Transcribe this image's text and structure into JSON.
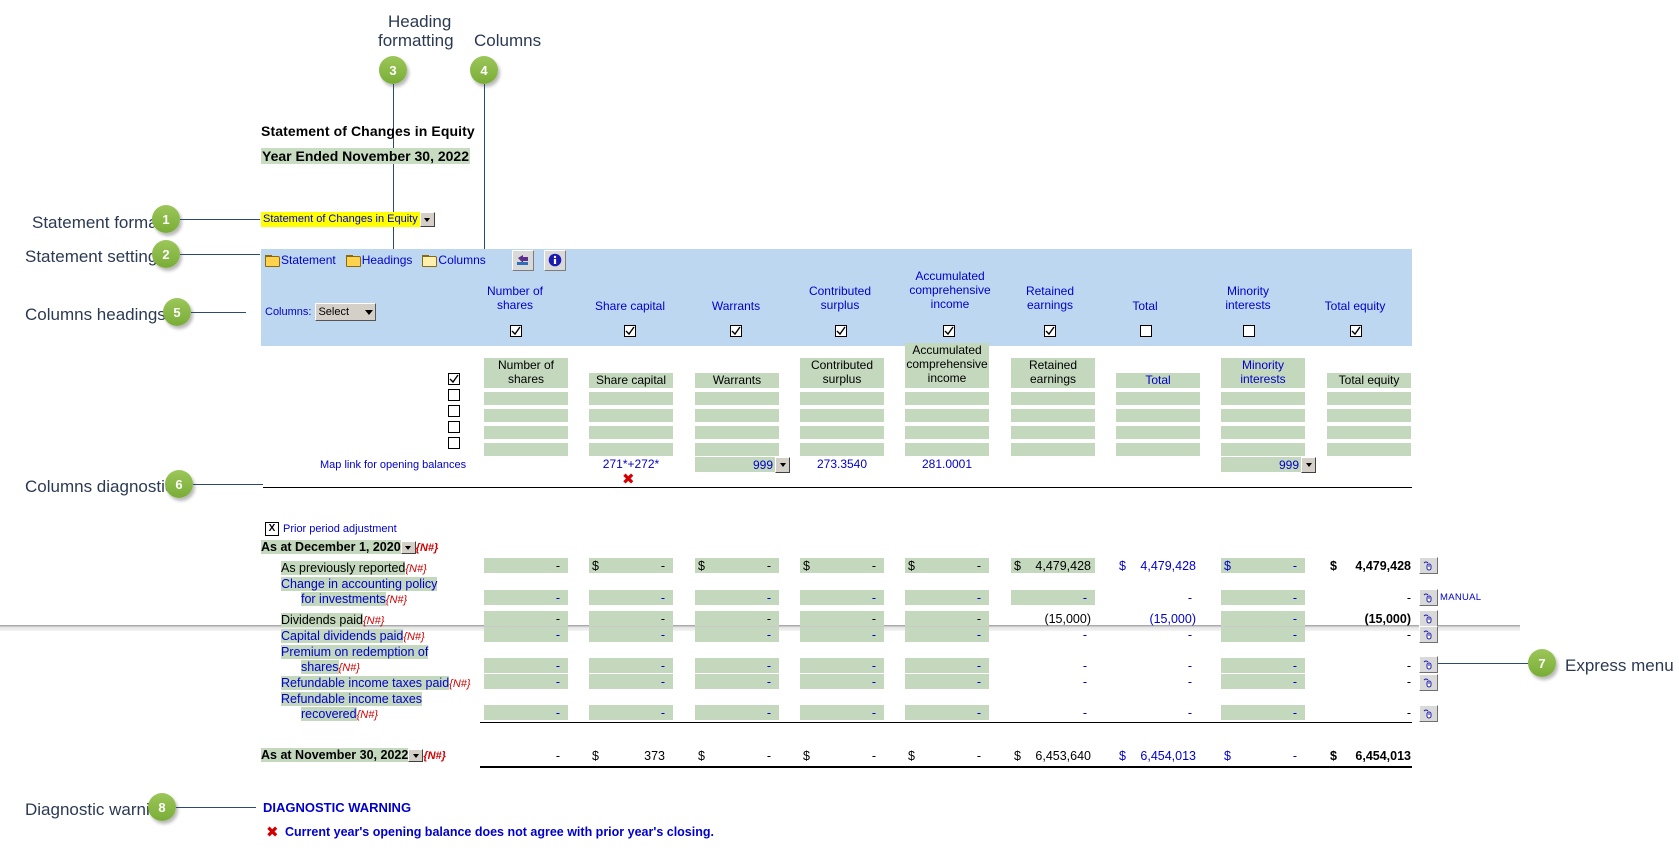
{
  "callouts": [
    {
      "n": "1",
      "label": "Statement format"
    },
    {
      "n": "2",
      "label": "Statement settings"
    },
    {
      "n": "3",
      "label": "Heading\nformatting"
    },
    {
      "n": "4",
      "label": "Columns"
    },
    {
      "n": "5",
      "label": "Columns headings"
    },
    {
      "n": "6",
      "label": "Columns diagnostic"
    },
    {
      "n": "7",
      "label": "Express menu"
    },
    {
      "n": "8",
      "label": "Diagnostic warning"
    }
  ],
  "callout_texts": {
    "c1": "Statement format",
    "c2": "Statement settings",
    "c3_line1": "Heading",
    "c3_line2": "formatting",
    "c4": "Columns",
    "c5": "Columns headings",
    "c6": "Columns diagnostic",
    "c7": "Express menu",
    "c8": "Diagnostic warning",
    "n1": "1",
    "n2": "2",
    "n3": "3",
    "n4": "4",
    "n5": "5",
    "n6": "6",
    "n7": "7",
    "n8": "8"
  },
  "statement": {
    "title": "Statement of Changes in Equity",
    "subtitle": "Year Ended November 30, 2022",
    "format_select_value": "Statement of Changes in Equity"
  },
  "settings_tabs": [
    {
      "label": "Statement",
      "icon": "folder-icon"
    },
    {
      "label": "Headings",
      "icon": "folder-icon"
    },
    {
      "label": "Columns",
      "icon": "folder-open-icon"
    }
  ],
  "toolbar": {
    "refresh_icon": "undo-arrow-icon",
    "info_icon": "info-icon"
  },
  "columns_selector": {
    "label": "Columns:",
    "value": "Select"
  },
  "columns": [
    {
      "name": "Number of shares",
      "line1": "Number of",
      "line2": "shares",
      "checked": true,
      "header_blue": true,
      "grid_header_blue": false,
      "map": ""
    },
    {
      "name": "Share capital",
      "line1": "Share capital",
      "line2": "",
      "checked": true,
      "header_blue": true,
      "grid_header_blue": false,
      "map": "271*+272*"
    },
    {
      "name": "Warrants",
      "line1": "Warrants",
      "line2": "",
      "checked": true,
      "header_blue": true,
      "grid_header_blue": false,
      "map": "999"
    },
    {
      "name": "Contributed surplus",
      "line1": "Contributed",
      "line2": "surplus",
      "checked": true,
      "header_blue": true,
      "grid_header_blue": false,
      "map": "273.3540"
    },
    {
      "name": "Accumulated comprehensive income",
      "line1": "Accumulated",
      "line2": "comprehensive",
      "line3": "income",
      "checked": true,
      "header_blue": true,
      "grid_header_blue": false,
      "map": "281.0001"
    },
    {
      "name": "Retained earnings",
      "line1": "Retained",
      "line2": "earnings",
      "checked": true,
      "header_blue": true,
      "grid_header_blue": false,
      "map": ""
    },
    {
      "name": "Total",
      "line1": "Total",
      "line2": "",
      "checked": false,
      "header_blue": true,
      "grid_header_blue": true,
      "map": ""
    },
    {
      "name": "Minority interests",
      "line1": "Minority",
      "line2": "interests",
      "checked": false,
      "header_blue": true,
      "grid_header_blue": true,
      "map": "999"
    },
    {
      "name": "Total equity",
      "line1": "Total equity",
      "line2": "",
      "checked": true,
      "header_blue": true,
      "grid_header_blue": false,
      "map": ""
    }
  ],
  "grid": {
    "map_link_label": "Map link for opening balances",
    "row_checkboxes": [
      true,
      false,
      false,
      false,
      false
    ]
  },
  "body": {
    "prior_period_adjustment": "Prior period adjustment",
    "prior_period_checked": "X",
    "opening_row_label": "As at December 1, 2020",
    "opening_row_tag": "{N#}",
    "closing_row_label": "As at November 30, 2022",
    "closing_row_tag": "{N#}",
    "manual_tag": "MANUAL",
    "rows": [
      {
        "label": "As previously reported",
        "tag": "{N#}",
        "label_color": "black"
      },
      {
        "label": "Change in accounting policy for investments",
        "tag": "{N#}",
        "label_color": "blue"
      },
      {
        "label": "Dividends paid",
        "tag": "{N#}",
        "label_color": "black"
      },
      {
        "label": "Capital dividends paid",
        "tag": "{N#}",
        "label_color": "blue"
      },
      {
        "label": "Premium on redemption of shares",
        "tag": "{N#}",
        "label_color": "blue"
      },
      {
        "label": "Refundable income taxes paid",
        "tag": "{N#}",
        "label_color": "blue"
      },
      {
        "label": "Refundable income taxes recovered",
        "tag": "{N#}",
        "label_color": "blue"
      }
    ],
    "values": {
      "as_previously_reported": [
        "-",
        "-",
        "-",
        "-",
        "-",
        "4,479,428",
        "4,479,428",
        "-",
        "4,479,428"
      ],
      "change_in_policy": [
        "-",
        "-",
        "-",
        "-",
        "-",
        "-",
        "-",
        "-",
        "-"
      ],
      "dividends_paid": [
        "-",
        "-",
        "-",
        "-",
        "-",
        "(15,000)",
        "(15,000)",
        "-",
        "(15,000)"
      ],
      "capital_dividends": [
        "-",
        "-",
        "-",
        "-",
        "-",
        "-",
        "-",
        "-",
        "-"
      ],
      "premium_redemption": [
        "-",
        "-",
        "-",
        "-",
        "-",
        "-",
        "-",
        "-",
        "-"
      ],
      "refundable_paid": [
        "-",
        "-",
        "-",
        "-",
        "-",
        "-",
        "-",
        "-",
        "-"
      ],
      "refundable_recovered": [
        "-",
        "-",
        "-",
        "-",
        "-",
        "-",
        "-",
        "-",
        "-"
      ],
      "closing": [
        "-",
        "373",
        "-",
        "-",
        "-",
        "6,453,640",
        "6,454,013",
        "-",
        "6,454,013"
      ]
    },
    "dollar_sign": "$"
  },
  "diagnostic": {
    "title": "DIAGNOSTIC WARNING",
    "x_mark": "✖",
    "message": "Current year's opening balance does not agree with prior year's closing."
  },
  "colors": {
    "accent_green": "#82b441",
    "band_blue": "#bdd7f0",
    "cell_green": "#c3d8bc",
    "link_blue": "#0000cc",
    "warn_red": "#d40000",
    "highlight_yellow": "#ffff00"
  }
}
